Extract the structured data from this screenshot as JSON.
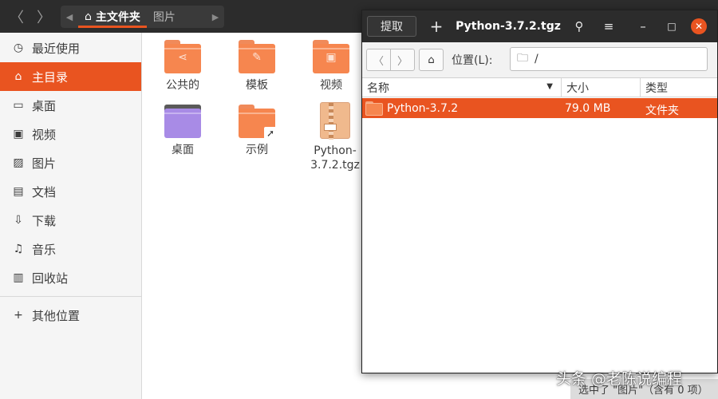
{
  "nautilus": {
    "path": [
      {
        "label": "主文件夹",
        "active": true
      },
      {
        "label": "图片",
        "active": false
      }
    ],
    "sidebar": [
      {
        "label": "最近使用",
        "icon": "clock-icon",
        "glyph": "◷"
      },
      {
        "label": "主目录",
        "icon": "home-icon",
        "glyph": "⌂",
        "active": true
      },
      {
        "label": "桌面",
        "icon": "desktop-icon",
        "glyph": "▭"
      },
      {
        "label": "视频",
        "icon": "video-icon",
        "glyph": "▣"
      },
      {
        "label": "图片",
        "icon": "picture-icon",
        "glyph": "▨"
      },
      {
        "label": "文档",
        "icon": "document-icon",
        "glyph": "▤"
      },
      {
        "label": "下载",
        "icon": "download-icon",
        "glyph": "⇩"
      },
      {
        "label": "音乐",
        "icon": "music-icon",
        "glyph": "♫"
      },
      {
        "label": "回收站",
        "icon": "trash-icon",
        "glyph": "▥"
      }
    ],
    "other_places": {
      "label": "其他位置",
      "icon": "plus-icon",
      "glyph": "+"
    },
    "files": [
      {
        "label": "公共的",
        "kind": "folder-share"
      },
      {
        "label": "模板",
        "kind": "folder-template"
      },
      {
        "label": "视频",
        "kind": "folder-video"
      },
      {
        "label": "桌面",
        "kind": "folder-desktop"
      },
      {
        "label": "示例",
        "kind": "folder-link"
      },
      {
        "label": "Python-3.7.2.tgz",
        "kind": "archive"
      }
    ],
    "status": "选中了 \"图片\"（含有 0 项）"
  },
  "file_roller": {
    "extract_label": "提取",
    "add_label": "+",
    "title": "Python-3.7.2.tgz",
    "location_label": "位置(L):",
    "location_value": "/",
    "columns": {
      "name": "名称",
      "size": "大小",
      "type": "类型"
    },
    "rows": [
      {
        "name": "Python-3.7.2",
        "size": "79.0 MB",
        "type": "文件夹"
      }
    ]
  },
  "watermark": "头条 @老陈说编程",
  "colors": {
    "accent": "#e95420",
    "header": "#2c2c2c",
    "sidebar": "#f5f5f5"
  }
}
